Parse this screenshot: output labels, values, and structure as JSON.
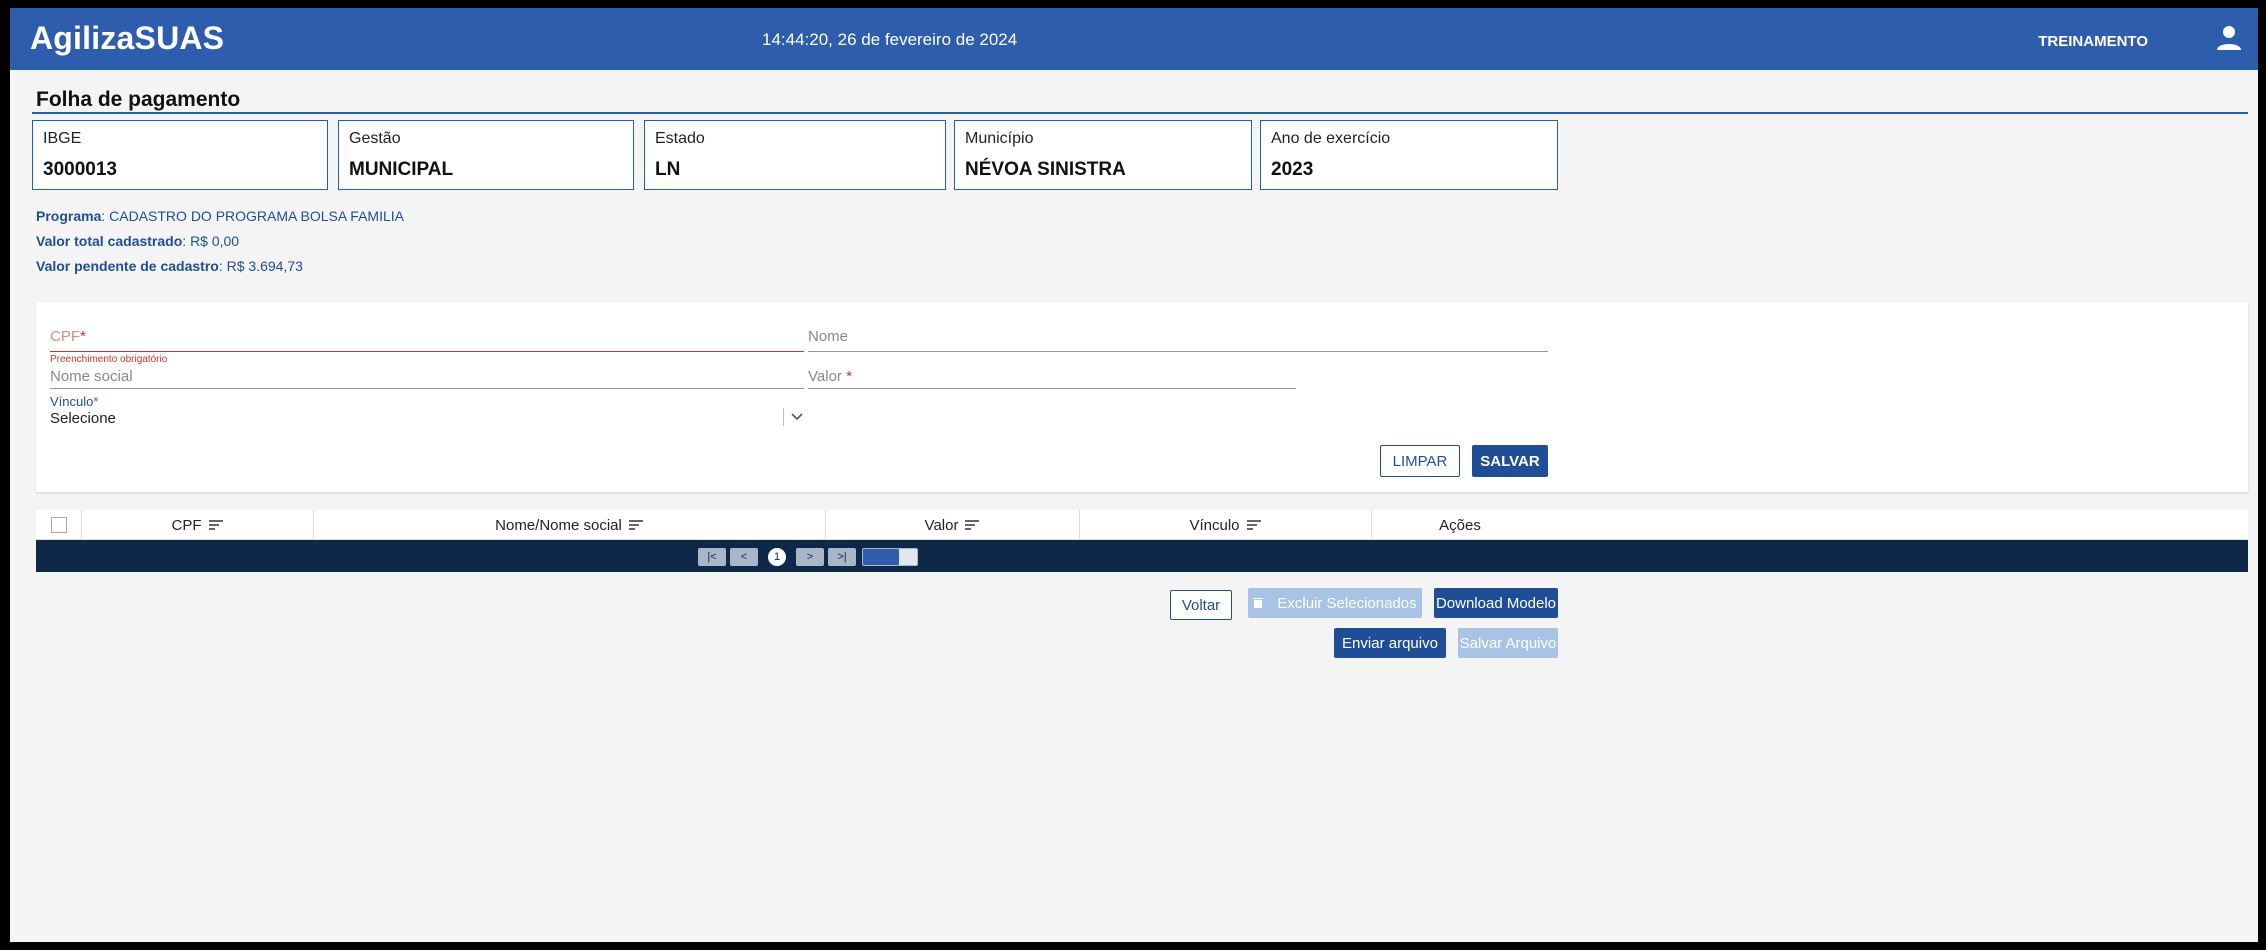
{
  "header": {
    "brand": "AgilizaSUAS",
    "datetime": "14:44:20, 26 de fevereiro de 2024",
    "user_label": "TREINAMENTO",
    "user_icon": "user-icon"
  },
  "page": {
    "title": "Folha de pagamento"
  },
  "cards": [
    {
      "label": "IBGE",
      "value": "3000013"
    },
    {
      "label": "Gestão",
      "value": "MUNICIPAL"
    },
    {
      "label": "Estado",
      "value": "LN"
    },
    {
      "label": "Município",
      "value": "NÉVOA SINISTRA"
    },
    {
      "label": "Ano de exercício",
      "value": "2023"
    }
  ],
  "info": {
    "programa_label": "Programa",
    "programa_value": "CADASTRO DO PROGRAMA BOLSA FAMILIA",
    "total_label": "Valor total cadastrado",
    "total_value": "R$ 0,00",
    "pendente_label": "Valor pendente de cadastro",
    "pendente_value": "R$ 3.694,73"
  },
  "form": {
    "cpf_label": "CPF",
    "cpf_error": "Preenchimento obrigatório",
    "nome_label": "Nome",
    "nome_social_label": "Nome social",
    "valor_label": "Valor",
    "vinculo_label": "Vínculo",
    "vinculo_value": "Selecione",
    "required_mark": "*",
    "clear_button": "LIMPAR",
    "save_button": "SALVAR"
  },
  "table": {
    "columns": [
      "CPF",
      "Nome/Nome social",
      "Valor",
      "Vínculo",
      "Ações"
    ],
    "pager": {
      "first": "|<",
      "prev": "<",
      "current": "1",
      "next": ">",
      "last": ">|"
    }
  },
  "actions": {
    "voltar": "Voltar",
    "excluir": "Excluir Selecionados",
    "download": "Download Modelo",
    "enviar": "Enviar arquivo",
    "salvar_arquivo": "Salvar Arquivo"
  },
  "colors": {
    "primary": "#2f5dad",
    "dark": "#102848",
    "error": "#c0392b"
  }
}
